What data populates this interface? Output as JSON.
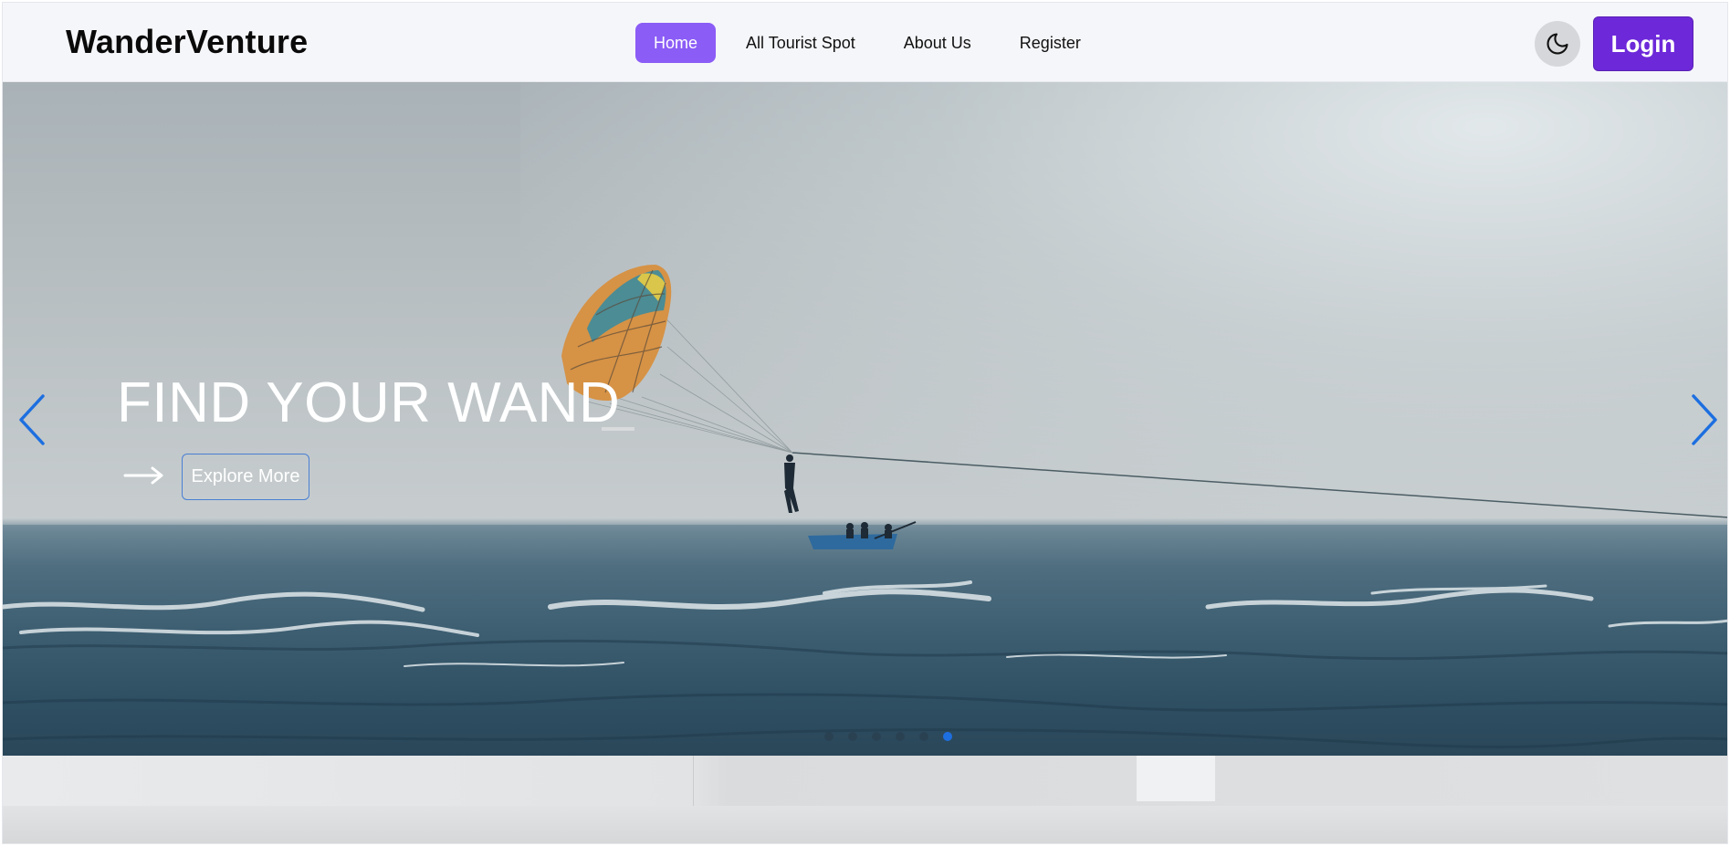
{
  "brand": "WanderVenture",
  "nav": {
    "links": [
      {
        "label": "Home",
        "active": true
      },
      {
        "label": "All Tourist Spot",
        "active": false
      },
      {
        "label": "About Us",
        "active": false
      },
      {
        "label": "Register",
        "active": false
      }
    ],
    "theme_toggle_icon": "moon-icon",
    "login_label": "Login",
    "accent_color": "#8b5cf6",
    "login_color": "#6d28d9"
  },
  "hero": {
    "title": "FIND YOUR WAND",
    "cta_label": "Explore More",
    "cta_icon": "arrow-right-icon",
    "prev_icon": "chevron-left-icon",
    "next_icon": "chevron-right-icon",
    "slide_count": 6,
    "active_slide": 6,
    "arrow_color": "#1d6fe0"
  }
}
